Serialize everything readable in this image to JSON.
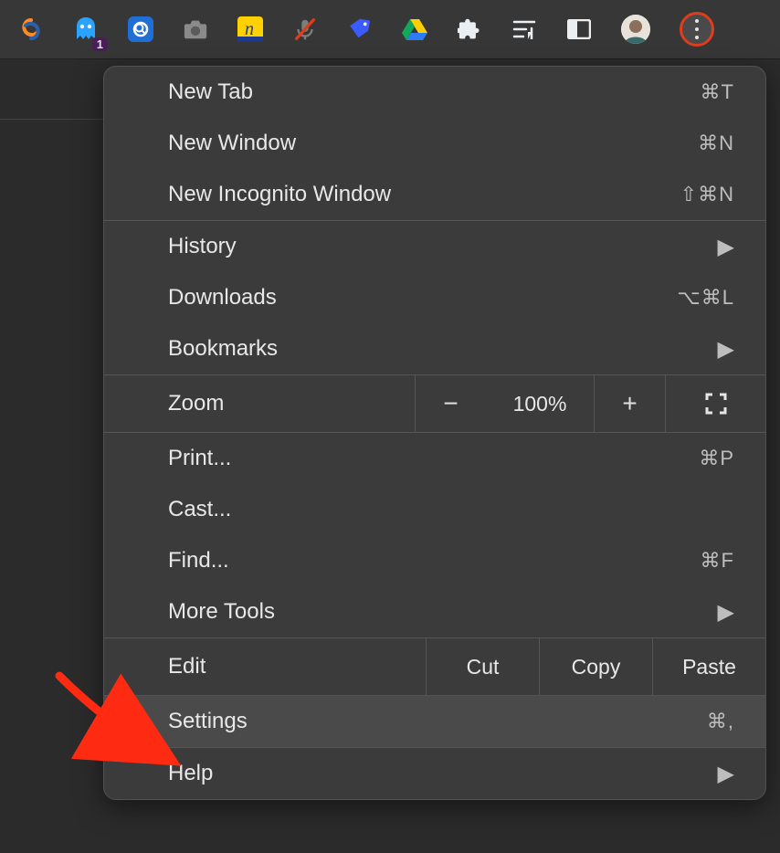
{
  "toolbar": {
    "badge_count": "1"
  },
  "menu": {
    "new_tab": {
      "label": "New Tab",
      "shortcut": "⌘T"
    },
    "new_window": {
      "label": "New Window",
      "shortcut": "⌘N"
    },
    "new_incognito": {
      "label": "New Incognito Window",
      "shortcut": "⇧⌘N"
    },
    "history": {
      "label": "History"
    },
    "downloads": {
      "label": "Downloads",
      "shortcut": "⌥⌘L"
    },
    "bookmarks": {
      "label": "Bookmarks"
    },
    "zoom": {
      "label": "Zoom",
      "minus": "−",
      "value": "100%",
      "plus": "+"
    },
    "print": {
      "label": "Print...",
      "shortcut": "⌘P"
    },
    "cast": {
      "label": "Cast..."
    },
    "find": {
      "label": "Find...",
      "shortcut": "⌘F"
    },
    "more_tools": {
      "label": "More Tools"
    },
    "edit": {
      "label": "Edit",
      "cut": "Cut",
      "copy": "Copy",
      "paste": "Paste"
    },
    "settings": {
      "label": "Settings",
      "shortcut": "⌘,"
    },
    "help": {
      "label": "Help"
    }
  }
}
